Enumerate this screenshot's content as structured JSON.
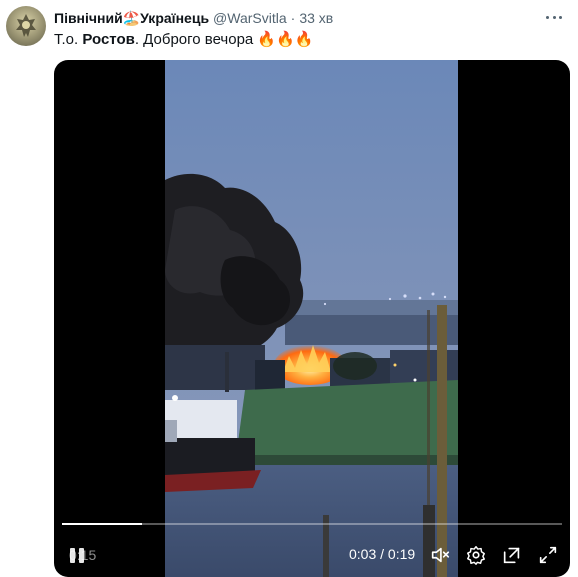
{
  "tweet": {
    "author_name": "Північний🏖️Українець",
    "handle": "@WarSvitla",
    "separator": "·",
    "time": "33 хв",
    "text_prefix": "Т.о. ",
    "text_bold": "Ростов",
    "text_suffix": ". Доброго вечора 🔥🔥🔥"
  },
  "video": {
    "progress": 0.16,
    "remaining_label": "0:15",
    "current_time": "0:03",
    "time_separator": " / ",
    "duration": "0:19"
  },
  "icons": {
    "more": "more-dots-icon",
    "pause": "pause-icon",
    "mute": "volume-muted-icon",
    "settings": "gear-icon",
    "popout": "popout-icon",
    "fullscreen": "fullscreen-icon"
  },
  "colors": {
    "text": "#0f1419",
    "secondary": "#536471",
    "fire": "#ff7a1a",
    "sky": "#6e87b3"
  }
}
